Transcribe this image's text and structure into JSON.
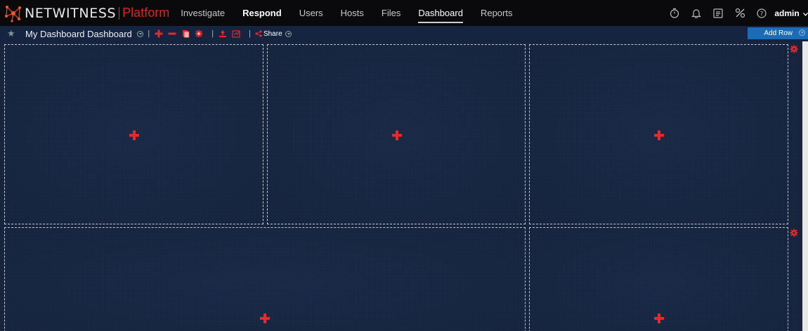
{
  "brand": {
    "name": "NETWITNESS",
    "product": "Platform"
  },
  "nav": {
    "items": [
      {
        "label": "Investigate",
        "bold": false,
        "active": false
      },
      {
        "label": "Respond",
        "bold": true,
        "active": false
      },
      {
        "label": "Users",
        "bold": false,
        "active": false
      },
      {
        "label": "Hosts",
        "bold": false,
        "active": false
      },
      {
        "label": "Files",
        "bold": false,
        "active": false
      },
      {
        "label": "Dashboard",
        "bold": false,
        "active": true
      },
      {
        "label": "Reports",
        "bold": false,
        "active": false
      }
    ],
    "right_icons": [
      "timer-icon",
      "bell-icon",
      "task-list-icon",
      "tools-icon",
      "help-icon"
    ],
    "user": "admin"
  },
  "toolbar": {
    "title": "My Dashboard Dashboard",
    "share_label": "Share",
    "add_row_label": "Add Row",
    "tools": [
      "add-dashlet-icon",
      "remove-dashlet-icon",
      "copy-dashboard-icon",
      "settings-icon",
      "import-icon",
      "export-icon"
    ]
  },
  "dashboard": {
    "rows": [
      {
        "cells": 3
      },
      {
        "cells": 2
      }
    ]
  },
  "colors": {
    "accent_red": "#e52a2a",
    "brand_red": "#d52727",
    "primary_blue": "#1b6bb5",
    "nav_bg": "#0a0a0c",
    "canvas_bg": "#1c2c4a"
  }
}
